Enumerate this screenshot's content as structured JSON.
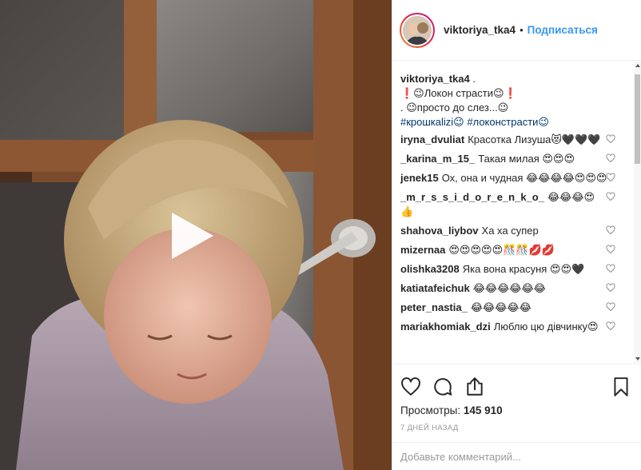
{
  "header": {
    "username": "viktoriya_tka4",
    "separator": "•",
    "follow_label": "Подписаться"
  },
  "caption": {
    "username": "viktoriya_tka4",
    "after_username": " .",
    "line2": "❗️😉Локон страсти😉❗️",
    "line3": ". 😉просто до слез...😉",
    "hashtags": [
      "#крошкаlizi😉",
      "#локонстрасти😉"
    ]
  },
  "comments": [
    {
      "user": "iryna_dvuliat",
      "text": "Красотка Лизуша😻🖤🖤🖤"
    },
    {
      "user": "_karina_m_15_",
      "text": "Такая милая 😍😍😍"
    },
    {
      "user": "jenek15",
      "text": "Ох, она и чудная 😂😂😂😂😍😍😍"
    },
    {
      "user": "_m_r_s_s_i_d_o_r_e_n_k_o_",
      "text": "😂😂😂😍👍"
    },
    {
      "user": "shahova_liybov",
      "text": "Ха ха супер"
    },
    {
      "user": "mizernaa",
      "text": "😍😍😍😍😍🎊🎊💋💋"
    },
    {
      "user": "olishka3208",
      "text": "Яка вона красуня 😍😍🖤"
    },
    {
      "user": "katiatafeichuk",
      "text": "😂😂😂😂😂😂"
    },
    {
      "user": "peter_nastia_",
      "text": "😂😂😂😂😂"
    },
    {
      "user": "mariakhomiak_dzi",
      "text": "Люблю цю дівчинку😍"
    }
  ],
  "actions": {
    "views_label": "Просмотры:",
    "views_count": "145 910",
    "date": "7 ДНЕЙ НАЗАД"
  },
  "add_comment": {
    "placeholder": "Добавьте комментарий..."
  },
  "icons": {
    "like": "heart-icon",
    "comment": "comment-icon",
    "share": "share-icon",
    "save": "bookmark-icon",
    "play": "play-icon"
  },
  "colors": {
    "link": "#3897f0",
    "hashtag": "#003569",
    "muted": "#999999"
  }
}
